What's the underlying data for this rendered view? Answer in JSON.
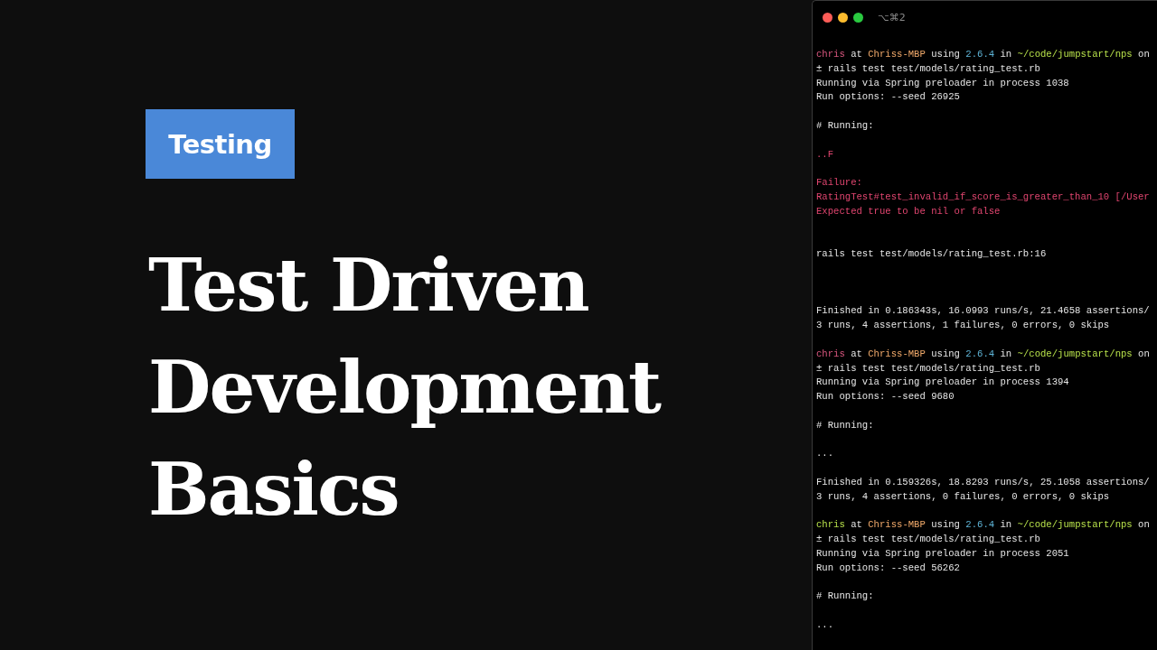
{
  "tag": "Testing",
  "title_lines": [
    "Test Driven",
    "Development",
    "Basics"
  ],
  "terminal": {
    "title": "⌥⌘2",
    "lines": [
      {
        "kind": "text",
        "segments": [
          {
            "text": "chris",
            "kind": "user"
          },
          {
            "text": " at ",
            "kind": "plain"
          },
          {
            "text": "Chriss-MBP",
            "kind": "host"
          },
          {
            "text": " using ",
            "kind": "plain"
          },
          {
            "text": "2.6.4",
            "kind": "version"
          },
          {
            "text": " in ",
            "kind": "plain"
          },
          {
            "text": "~/code/jumpstart/nps",
            "kind": "path"
          },
          {
            "text": " on",
            "kind": "plain"
          }
        ]
      },
      {
        "kind": "text",
        "segments": [
          {
            "text": "± rails test test/models/rating_test.rb",
            "kind": "plain"
          }
        ]
      },
      {
        "kind": "text",
        "segments": [
          {
            "text": "Running via Spring preloader in process 1038",
            "kind": "plain"
          }
        ]
      },
      {
        "kind": "text",
        "segments": [
          {
            "text": "Run options: --seed 26925",
            "kind": "plain"
          }
        ]
      },
      {
        "kind": "blank"
      },
      {
        "kind": "text",
        "segments": [
          {
            "text": "# Running:",
            "kind": "plain"
          }
        ]
      },
      {
        "kind": "blank"
      },
      {
        "kind": "text",
        "segments": [
          {
            "text": "..F",
            "kind": "error"
          }
        ]
      },
      {
        "kind": "blank"
      },
      {
        "kind": "text",
        "segments": [
          {
            "text": "Failure:",
            "kind": "error"
          }
        ]
      },
      {
        "kind": "text",
        "segments": [
          {
            "text": "RatingTest#test_invalid_if_score_is_greater_than_10 [/User",
            "kind": "error"
          }
        ]
      },
      {
        "kind": "text",
        "segments": [
          {
            "text": "Expected true to be nil or false",
            "kind": "error"
          }
        ]
      },
      {
        "kind": "blank"
      },
      {
        "kind": "blank"
      },
      {
        "kind": "text",
        "segments": [
          {
            "text": "rails test test/models/rating_test.rb:16",
            "kind": "plain"
          }
        ]
      },
      {
        "kind": "blank"
      },
      {
        "kind": "blank"
      },
      {
        "kind": "blank"
      },
      {
        "kind": "text",
        "segments": [
          {
            "text": "Finished in 0.186343s, 16.0993 runs/s, 21.4658 assertions/",
            "kind": "plain"
          }
        ]
      },
      {
        "kind": "text",
        "segments": [
          {
            "text": "3 runs, 4 assertions, 1 failures, 0 errors, 0 skips",
            "kind": "plain"
          }
        ]
      },
      {
        "kind": "blank"
      },
      {
        "kind": "text",
        "segments": [
          {
            "text": "chris",
            "kind": "user"
          },
          {
            "text": " at ",
            "kind": "plain"
          },
          {
            "text": "Chriss-MBP",
            "kind": "host"
          },
          {
            "text": " using ",
            "kind": "plain"
          },
          {
            "text": "2.6.4",
            "kind": "version"
          },
          {
            "text": " in ",
            "kind": "plain"
          },
          {
            "text": "~/code/jumpstart/nps",
            "kind": "path"
          },
          {
            "text": " on",
            "kind": "plain"
          }
        ]
      },
      {
        "kind": "text",
        "segments": [
          {
            "text": "± rails test test/models/rating_test.rb",
            "kind": "plain"
          }
        ]
      },
      {
        "kind": "text",
        "segments": [
          {
            "text": "Running via Spring preloader in process 1394",
            "kind": "plain"
          }
        ]
      },
      {
        "kind": "text",
        "segments": [
          {
            "text": "Run options: --seed 9680",
            "kind": "plain"
          }
        ]
      },
      {
        "kind": "blank"
      },
      {
        "kind": "text",
        "segments": [
          {
            "text": "# Running:",
            "kind": "plain"
          }
        ]
      },
      {
        "kind": "blank"
      },
      {
        "kind": "text",
        "segments": [
          {
            "text": "...",
            "kind": "plain"
          }
        ]
      },
      {
        "kind": "blank"
      },
      {
        "kind": "text",
        "segments": [
          {
            "text": "Finished in 0.159326s, 18.8293 runs/s, 25.1058 assertions/",
            "kind": "plain"
          }
        ]
      },
      {
        "kind": "text",
        "segments": [
          {
            "text": "3 runs, 4 assertions, 0 failures, 0 errors, 0 skips",
            "kind": "plain"
          }
        ]
      },
      {
        "kind": "blank"
      },
      {
        "kind": "text",
        "segments": [
          {
            "text": "chris",
            "kind": "success"
          },
          {
            "text": " at ",
            "kind": "plain"
          },
          {
            "text": "Chriss-MBP",
            "kind": "host"
          },
          {
            "text": " using ",
            "kind": "plain"
          },
          {
            "text": "2.6.4",
            "kind": "version"
          },
          {
            "text": " in ",
            "kind": "plain"
          },
          {
            "text": "~/code/jumpstart/nps",
            "kind": "path"
          },
          {
            "text": " on",
            "kind": "plain"
          }
        ]
      },
      {
        "kind": "text",
        "segments": [
          {
            "text": "± rails test test/models/rating_test.rb",
            "kind": "plain"
          }
        ]
      },
      {
        "kind": "text",
        "segments": [
          {
            "text": "Running via Spring preloader in process 2051",
            "kind": "plain"
          }
        ]
      },
      {
        "kind": "text",
        "segments": [
          {
            "text": "Run options: --seed 56262",
            "kind": "plain"
          }
        ]
      },
      {
        "kind": "blank"
      },
      {
        "kind": "text",
        "segments": [
          {
            "text": "# Running:",
            "kind": "plain"
          }
        ]
      },
      {
        "kind": "blank"
      },
      {
        "kind": "text",
        "segments": [
          {
            "text": "...",
            "kind": "plain"
          }
        ]
      }
    ]
  }
}
